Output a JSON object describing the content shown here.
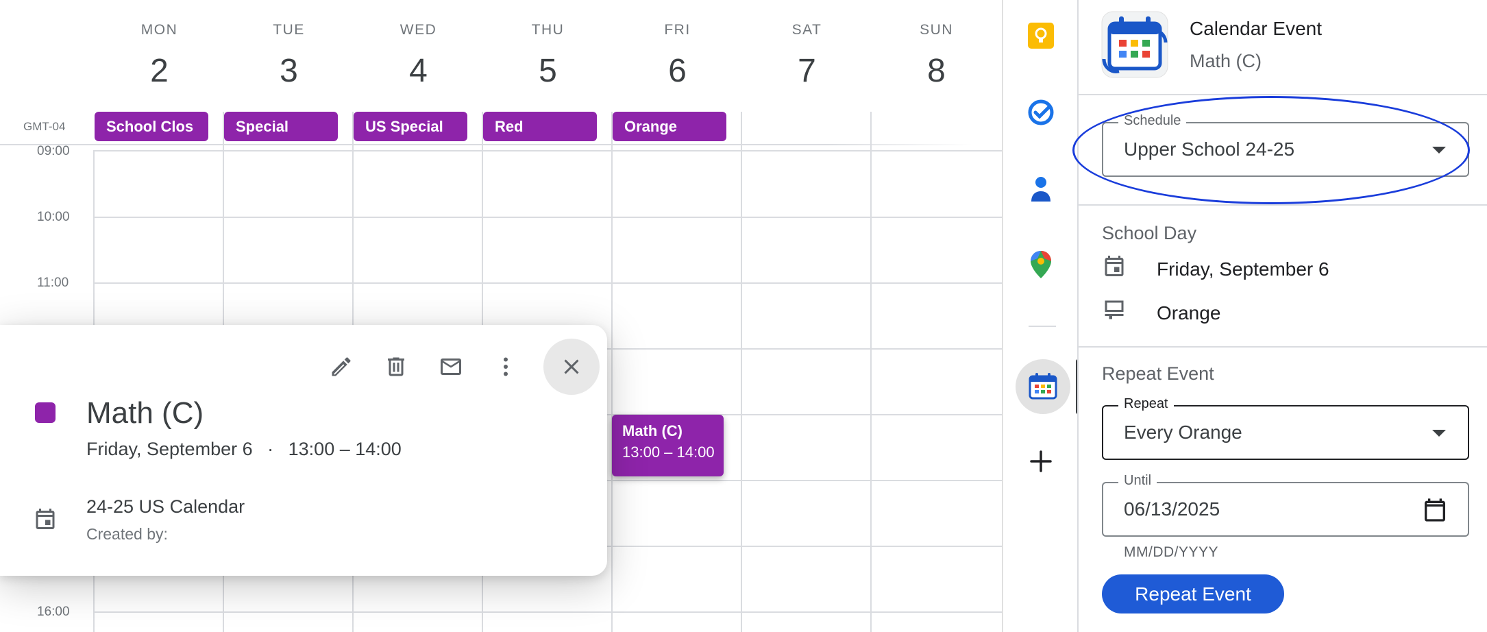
{
  "calendar": {
    "timezone": "GMT-04",
    "days": [
      {
        "name": "MON",
        "number": "2"
      },
      {
        "name": "TUE",
        "number": "3"
      },
      {
        "name": "WED",
        "number": "4"
      },
      {
        "name": "THU",
        "number": "5"
      },
      {
        "name": "FRI",
        "number": "6"
      },
      {
        "name": "SAT",
        "number": "7"
      },
      {
        "name": "SUN",
        "number": "8"
      }
    ],
    "all_day_events": [
      {
        "label": "School Clos"
      },
      {
        "label": "Special"
      },
      {
        "label": "US Special"
      },
      {
        "label": "Red"
      },
      {
        "label": "Orange"
      }
    ],
    "time_labels": [
      "09:00",
      "10:00",
      "11:00",
      "16:00"
    ],
    "event": {
      "title": "Math (C)",
      "time": "13:00 – 14:00",
      "color": "#8e24aa"
    }
  },
  "popup": {
    "title": "Math (C)",
    "date": "Friday, September 6",
    "separator": "·",
    "time": "13:00 – 14:00",
    "calendar_name": "24-25 US Calendar",
    "created_by": "Created by:",
    "icons": [
      "pencil-icon",
      "trash-icon",
      "mail-icon",
      "more-vert-icon",
      "close-icon"
    ]
  },
  "rail": {
    "icons": [
      "keep-icon",
      "tasks-icon",
      "contacts-icon",
      "maps-icon",
      "calendar-addon-icon",
      "add-icon"
    ]
  },
  "panel": {
    "title": "Calendar Event",
    "subtitle": "Math (C)",
    "schedule": {
      "label": "Schedule",
      "value": "Upper School 24-25"
    },
    "school_day": {
      "heading": "School Day",
      "date": "Friday, September 6",
      "day": "Orange"
    },
    "repeat_section": {
      "heading": "Repeat Event"
    },
    "repeat": {
      "label": "Repeat",
      "value": "Every Orange"
    },
    "until": {
      "label": "Until",
      "value": "06/13/2025",
      "hint": "MM/DD/YYYY"
    },
    "button_label": "Repeat Event",
    "accent_color": "#1f5bd6",
    "highlight_color": "#1a3ddb"
  }
}
